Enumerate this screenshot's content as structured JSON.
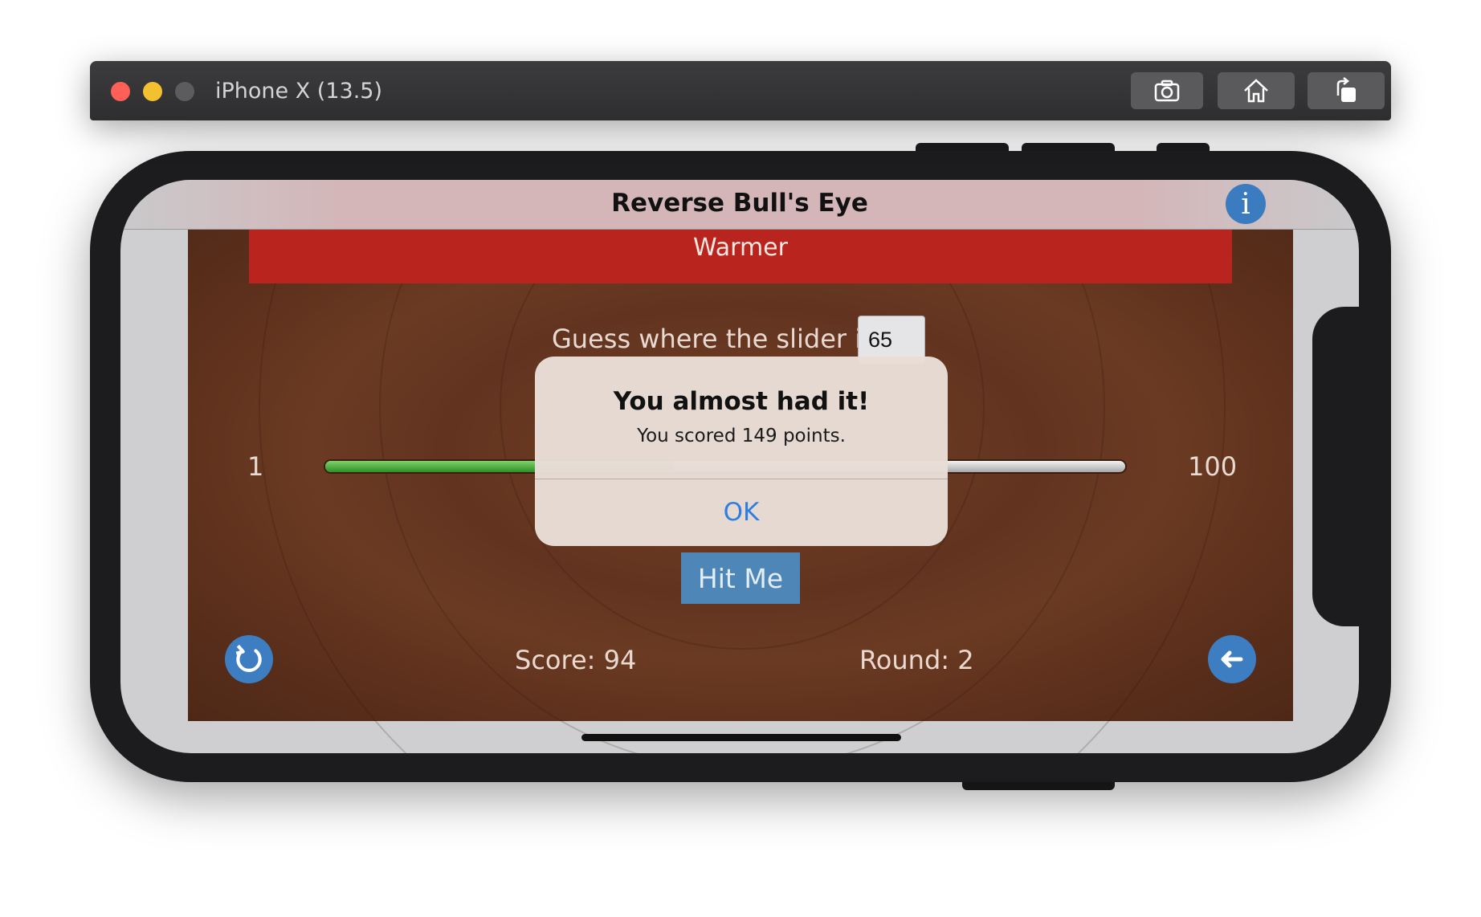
{
  "window": {
    "title": "iPhone X (13.5)",
    "toolbar": [
      "camera-icon",
      "home-icon",
      "rotate-icon"
    ]
  },
  "nav": {
    "title": "Reverse Bull's Eye",
    "info_icon": "i"
  },
  "banner": {
    "text": "Warmer",
    "color": "#b9241e"
  },
  "guess": {
    "label": "Guess where the slider is:",
    "value": "65"
  },
  "slider": {
    "min_label": "1",
    "max_label": "100",
    "value": 44
  },
  "actions": {
    "hit_label": "Hit Me"
  },
  "status": {
    "score": "Score: 94",
    "round": "Round: 2"
  },
  "alert": {
    "title": "You almost had it!",
    "message": "You scored 149 points.",
    "ok_label": "OK"
  },
  "colors": {
    "accent": "#3d7dc2",
    "alert_button": "#2f7de0",
    "slider_fill": "#4caf50"
  }
}
